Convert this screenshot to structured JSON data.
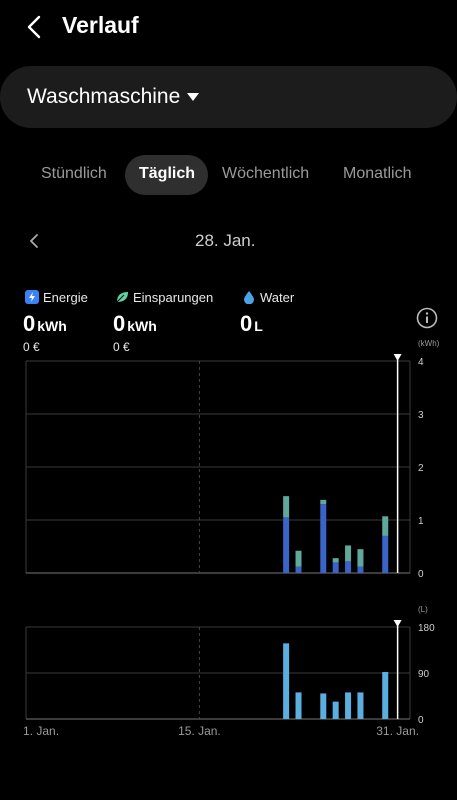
{
  "header": {
    "title": "Verlauf"
  },
  "device": {
    "name": "Waschmaschine"
  },
  "tabs": [
    {
      "label": "Stündlich",
      "active": false
    },
    {
      "label": "Täglich",
      "active": true
    },
    {
      "label": "Wöchentlich",
      "active": false
    },
    {
      "label": "Monatlich",
      "active": false
    }
  ],
  "date": {
    "label": "28. Jan."
  },
  "metrics": {
    "energy": {
      "label": "Energie",
      "value": "0",
      "unit": "kWh",
      "cost": "0 €",
      "icon": "lightning-icon",
      "color": "#3b82f6"
    },
    "savings": {
      "label": "Einsparungen",
      "value": "0",
      "unit": "kWh",
      "cost": "0 €",
      "icon": "leaf-icon",
      "color": "#5fd1a4"
    },
    "water": {
      "label": "Water",
      "value": "0",
      "unit": "L",
      "icon": "water-drop-icon",
      "color": "#4aa3e8"
    }
  },
  "chart_data": [
    {
      "type": "bar",
      "stacked": true,
      "ylabel": "(kWh)",
      "ylim": [
        0,
        4
      ],
      "yticks": [
        "0",
        "1",
        "2",
        "3",
        "4"
      ],
      "x_days": [
        22,
        23,
        25,
        26,
        27,
        28,
        30
      ],
      "series": [
        {
          "values": [
            1.05,
            0.12,
            1.3,
            0.2,
            0.22,
            0.12,
            0.7
          ],
          "color": "#3a64c8"
        },
        {
          "values": [
            0.4,
            0.3,
            0.08,
            0.08,
            0.3,
            0.33,
            0.37
          ],
          "color": "#5fa89a"
        }
      ],
      "marker_day": 31,
      "grid": true
    },
    {
      "type": "bar",
      "ylabel": "(L)",
      "ylim": [
        0,
        180
      ],
      "yticks": [
        "0",
        "90",
        "180"
      ],
      "x_days": [
        22,
        23,
        25,
        26,
        27,
        28,
        30
      ],
      "series": [
        {
          "values": [
            148,
            52,
            50,
            34,
            52,
            52,
            92
          ],
          "color": "#5aaee0"
        }
      ],
      "marker_day": 31,
      "xticks": [
        "1. Jan.",
        "15. Jan.",
        "31. Jan."
      ],
      "grid": true
    }
  ]
}
